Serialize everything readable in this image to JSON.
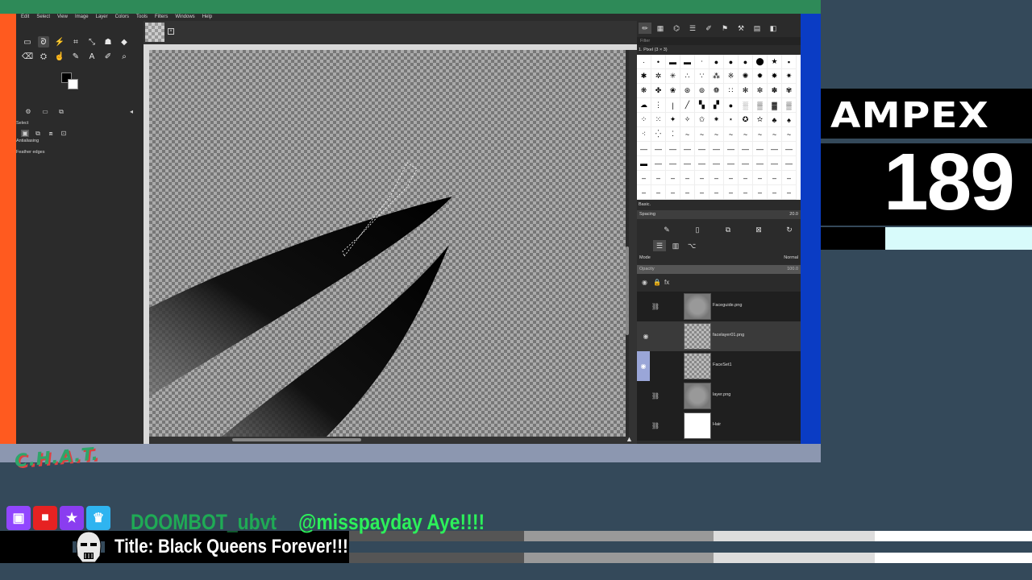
{
  "menu": [
    "Edit",
    "Select",
    "View",
    "Image",
    "Layer",
    "Colors",
    "Tools",
    "Filters",
    "Windows",
    "Help"
  ],
  "tool_options": {
    "section_label": "Select",
    "antialiasing_label": "Antialiasing",
    "feather_label": "Feather edges"
  },
  "brushes": {
    "filter_placeholder": "Filter",
    "selected_brush": "1. Pixel (3 × 3)",
    "preset_label": "Basic.",
    "spacing_label": "Spacing",
    "spacing_value": "20.0"
  },
  "layers": {
    "mode_label": "Mode",
    "mode_value": "Normal",
    "opacity_label": "Opacity",
    "opacity_value": "100.0",
    "items": [
      {
        "name": "Faceguide.png"
      },
      {
        "name": "facelayer01.png"
      },
      {
        "name": "FaceSet1"
      },
      {
        "name": "layer.png"
      },
      {
        "name": "Hair"
      }
    ]
  },
  "overlay": {
    "ampex_label": "AMPEX",
    "ampex_number": "189",
    "chat_logo": "C.H.A.T.",
    "chat_user": "DOOMBOT_ubvt",
    "chat_message": "@misspayday Aye!!!!",
    "stream_title": "Title: Black Queens Forever!!!"
  },
  "colors": {
    "accent_green": "#2e8a58",
    "accent_orange": "#ff5a1f",
    "accent_blue": "#0a3cc4",
    "chat_green": "#2cf05a"
  }
}
